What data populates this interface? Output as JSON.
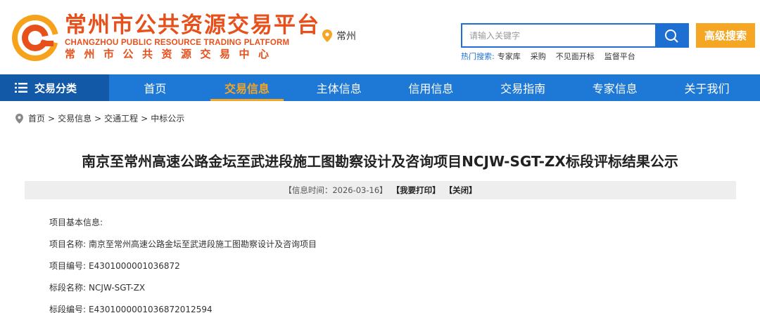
{
  "brand": {
    "name_cn": "常州市公共资源交易平台",
    "name_en": "CHANGZHOU PUBLIC RESOURCE TRADING PLATFORM",
    "name_sub": "常州市公共资源交易中心",
    "color": "#e8501b"
  },
  "location": {
    "city": "常州"
  },
  "search": {
    "placeholder": "请输入关键字",
    "value": "",
    "advanced_label": "高级搜索",
    "hot_label": "热门搜索:",
    "hot_items": [
      "专家库",
      "采购",
      "不见面开标",
      "监督平台"
    ]
  },
  "nav": {
    "category_label": "交易分类",
    "items": [
      {
        "label": "首页",
        "active": false
      },
      {
        "label": "交易信息",
        "active": true
      },
      {
        "label": "主体信息",
        "active": false
      },
      {
        "label": "信用信息",
        "active": false
      },
      {
        "label": "交易指南",
        "active": false
      },
      {
        "label": "专家信息",
        "active": false
      },
      {
        "label": "关于我们",
        "active": false
      }
    ],
    "bg_color": "#1e78d6",
    "active_color": "#f5a623"
  },
  "breadcrumb": {
    "items": [
      "首页",
      "交易信息",
      "交通工程",
      "中标公示"
    ],
    "separator": ">"
  },
  "article": {
    "title": "南京至常州高速公路金坛至武进段施工图勘察设计及咨询项目NCJW-SGT-ZX标段评标结果公示",
    "meta_time": "【信息时间：2026-03-16】",
    "print_label": "【我要打印】",
    "close_label": "【关闭】",
    "section_heading": "项目基本信息:",
    "fields": [
      {
        "label": "项目名称:",
        "value": "南京至常州高速公路金坛至武进段施工图勘察设计及咨询项目"
      },
      {
        "label": "项目编号:",
        "value": "E4301000001036872"
      },
      {
        "label": "标段名称:",
        "value": "NCJW-SGT-ZX"
      },
      {
        "label": "标段编号:",
        "value": "E4301000001036872012594"
      }
    ]
  }
}
